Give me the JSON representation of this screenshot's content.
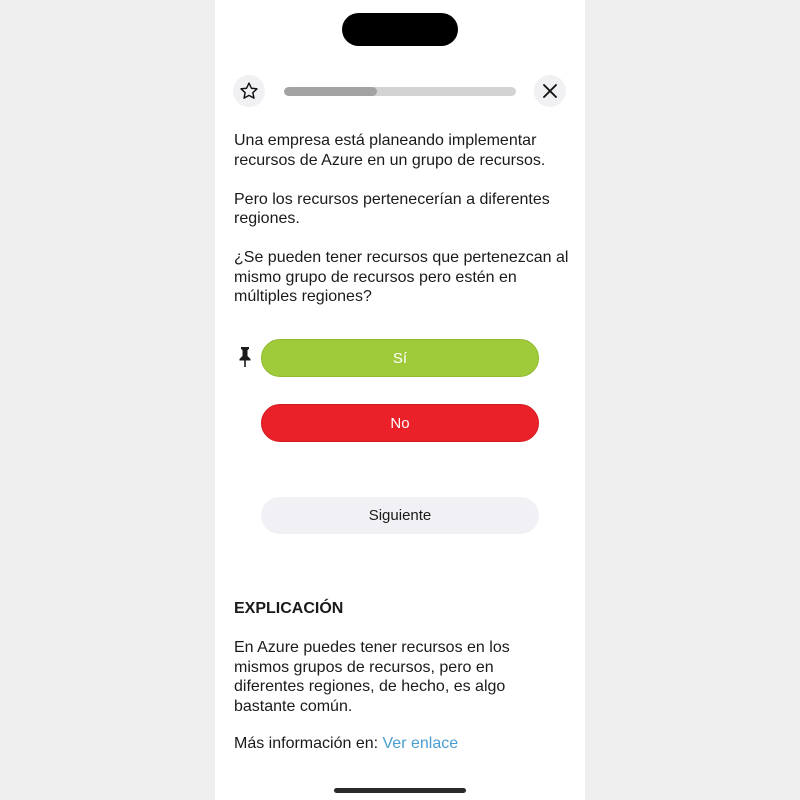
{
  "progress": {
    "fraction": 0.4
  },
  "icons": {
    "favorite": "star-icon",
    "close": "close-icon",
    "pin": "pin-icon"
  },
  "question": {
    "paragraphs": [
      "Una empresa está planeando implementar recursos de Azure en un grupo de recursos.",
      "Pero los recursos pertenecerían a diferentes regiones.",
      "¿Se pueden tener recursos que pertenezcan al mismo grupo de recursos pero estén en múltiples regiones?"
    ]
  },
  "answers": {
    "yes_label": "Sí",
    "no_label": "No"
  },
  "next_label": "Siguiente",
  "explanation": {
    "heading": "EXPLICACIÓN",
    "body": "En Azure puedes tener recursos en los mismos grupos de recursos, pero en diferentes regiones, de hecho, es algo bastante común.",
    "more_info_prefix": "Más información en:",
    "link_text": "Ver enlace"
  },
  "colors": {
    "yes": "#9fcb3a",
    "no": "#ea2128",
    "link": "#4a9ed0",
    "progress_track": "#d3d3d3",
    "progress_fill": "#a3a3a3"
  }
}
